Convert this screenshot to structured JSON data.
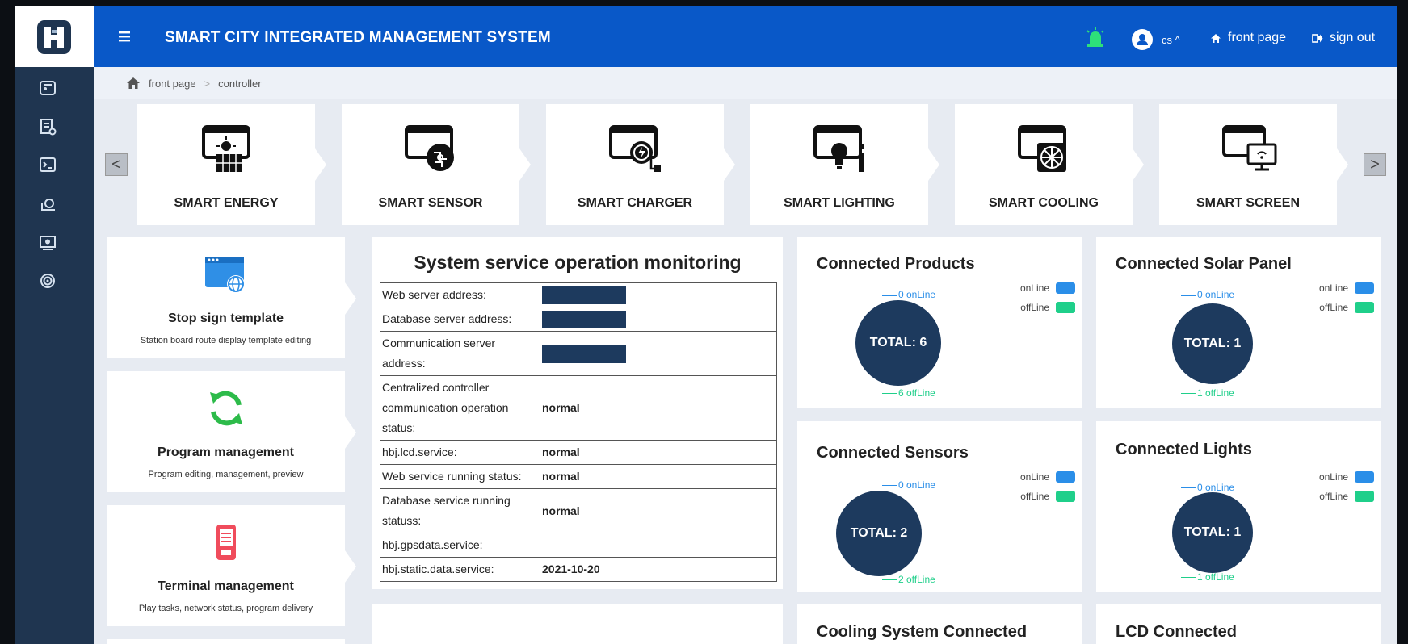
{
  "header": {
    "title": "SMART CITY INTEGRATED MANAGEMENT SYSTEM",
    "user": "cs ^",
    "home_label": "front page",
    "signout_label": "sign out"
  },
  "breadcrumb": {
    "items": [
      "front page",
      "controller"
    ],
    "separator": ">"
  },
  "sidebar": {
    "items": [
      {
        "icon": "dashboard-icon"
      },
      {
        "icon": "document-settings-icon"
      },
      {
        "icon": "terminal-icon"
      },
      {
        "icon": "monitor-icon"
      },
      {
        "icon": "display-icon"
      },
      {
        "icon": "radar-icon"
      }
    ]
  },
  "carousel": {
    "prev": "<",
    "next": ">",
    "items": [
      {
        "label": "SMART ENERGY",
        "icon": "energy-icon"
      },
      {
        "label": "SMART SENSOR",
        "icon": "sensor-icon"
      },
      {
        "label": "SMART CHARGER",
        "icon": "charger-icon"
      },
      {
        "label": "SMART LIGHTING",
        "icon": "lighting-icon"
      },
      {
        "label": "SMART COOLING",
        "icon": "cooling-icon"
      },
      {
        "label": "SMART SCREEN",
        "icon": "screen-icon"
      }
    ]
  },
  "menu_cards": [
    {
      "title": "Stop sign template",
      "desc": "Station board route display template editing",
      "icon": "web-template-icon"
    },
    {
      "title": "Program management",
      "desc": "Program editing, management, preview",
      "icon": "refresh-icon"
    },
    {
      "title": "Terminal management",
      "desc": "Play tasks, network status, program delivery",
      "icon": "terminal-device-icon"
    }
  ],
  "monitoring": {
    "title": "System service operation monitoring",
    "rows": [
      {
        "key": "Web server address:",
        "value": ""
      },
      {
        "key": "Database server address:",
        "value": ""
      },
      {
        "key": "Communication server address:",
        "value": ""
      },
      {
        "key": "Centralized controller communication operation status:",
        "value": "normal"
      },
      {
        "key": "hbj.lcd.service:",
        "value": "normal"
      },
      {
        "key": "Web service running status:",
        "value": "normal"
      },
      {
        "key": "Database service running statuss:",
        "value": "normal"
      },
      {
        "key": "hbj.gpsdata.service:",
        "value": ""
      },
      {
        "key": "hbj.static.data.service:",
        "value": "2021-10-20"
      }
    ]
  },
  "stats": [
    {
      "title": "Connected Products",
      "total_label": "TOTAL: 6",
      "online_label": "0 onLine",
      "offline_label": "6 offLine",
      "online": 0,
      "offline": 6
    },
    {
      "title": "Connected Solar Panel",
      "total_label": "TOTAL: 1",
      "online_label": "0 onLine",
      "offline_label": "1 offLine",
      "online": 0,
      "offline": 1
    },
    {
      "title": "Connected Sensors",
      "total_label": "TOTAL: 2",
      "online_label": "0 onLine",
      "offline_label": "2 offLine",
      "online": 0,
      "offline": 2
    },
    {
      "title": "Connected Lights",
      "total_label": "TOTAL: 1",
      "online_label": "0 onLine",
      "offline_label": "1 offLine",
      "online": 0,
      "offline": 1
    },
    {
      "title": "Cooling System Connected"
    },
    {
      "title": "LCD Connected"
    }
  ],
  "legend": {
    "online": "onLine",
    "offline": "offLine"
  },
  "colors": {
    "header_bg": "#0958c8",
    "sidebar_bg": "#1f3550",
    "circle_fill": "#1d3a5e",
    "online": "#2a8ee8",
    "offline": "#1fcf8a"
  }
}
